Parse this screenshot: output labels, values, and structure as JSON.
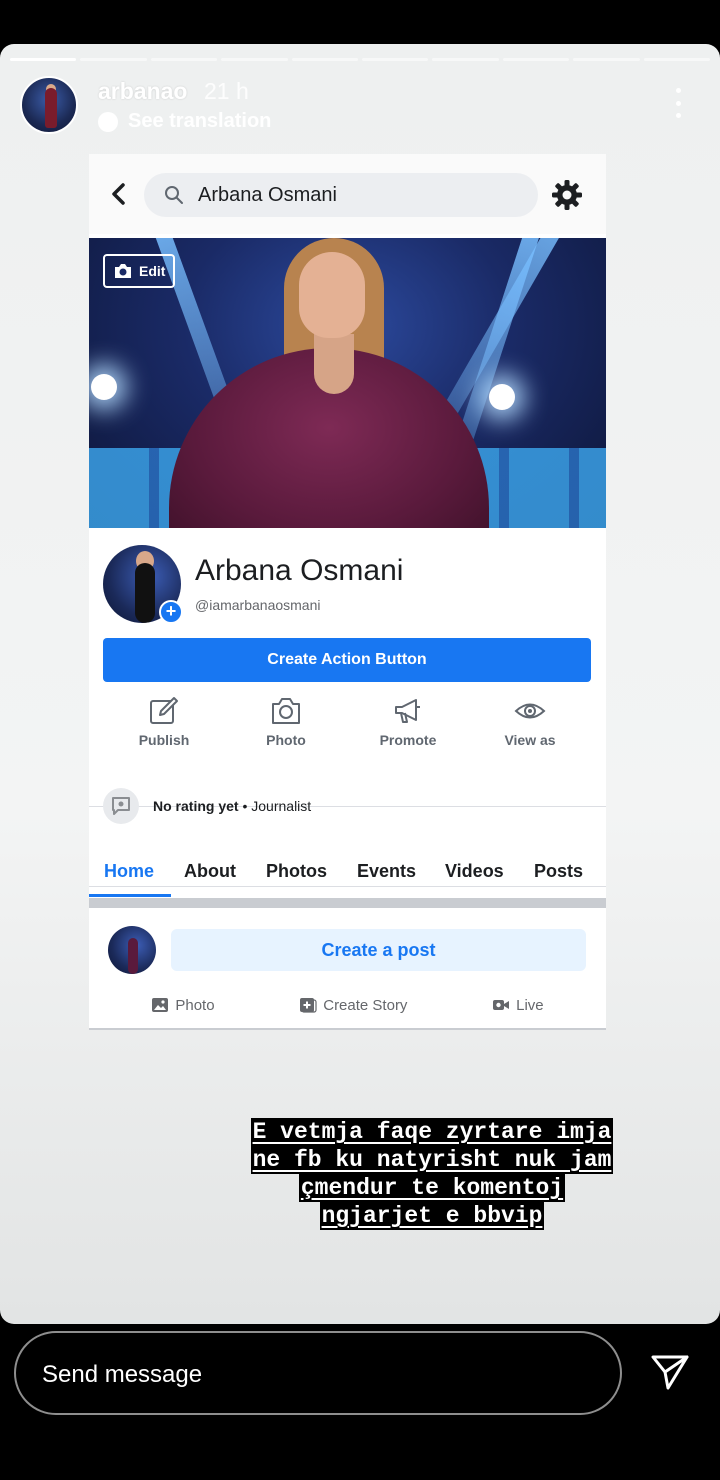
{
  "story": {
    "username": "arbanao",
    "time_ago": "21 h",
    "see_translation": "See translation",
    "icons": {
      "more": "more-vertical-icon"
    }
  },
  "facebook": {
    "search_value": "Arbana Osmani",
    "icons": {
      "back": "chevron-left-icon",
      "search": "search-icon",
      "settings": "gear-icon"
    },
    "cover": {
      "edit_label": "Edit"
    },
    "profile": {
      "name": "Arbana Osmani",
      "handle": "@iamarbanaosmani"
    },
    "action_button": "Create Action Button",
    "actions": [
      {
        "label": "Publish",
        "icon": "edit-icon"
      },
      {
        "label": "Photo",
        "icon": "camera-icon"
      },
      {
        "label": "Promote",
        "icon": "megaphone-icon"
      },
      {
        "label": "View as",
        "icon": "eye-icon"
      }
    ],
    "rating": {
      "status": "No rating yet",
      "separator": " • ",
      "category": "Journalist"
    },
    "tabs": [
      "Home",
      "About",
      "Photos",
      "Events",
      "Videos",
      "Posts"
    ],
    "active_tab": "Home",
    "create_post": "Create a post",
    "post_actions": [
      {
        "label": "Photo",
        "icon": "image-icon"
      },
      {
        "label": "Create Story",
        "icon": "plus-square-icon"
      },
      {
        "label": "Live",
        "icon": "video-icon"
      }
    ],
    "accent_color": "#1877f2"
  },
  "caption": {
    "lines": [
      "E vetmja faqe zyrtare imja",
      "ne fb ku natyrisht nuk jam",
      "çmendur te komentoj",
      "ngjarjet e bbvip"
    ]
  },
  "bottom_bar": {
    "message_placeholder": "Send message",
    "icons": {
      "send": "send-icon"
    }
  }
}
